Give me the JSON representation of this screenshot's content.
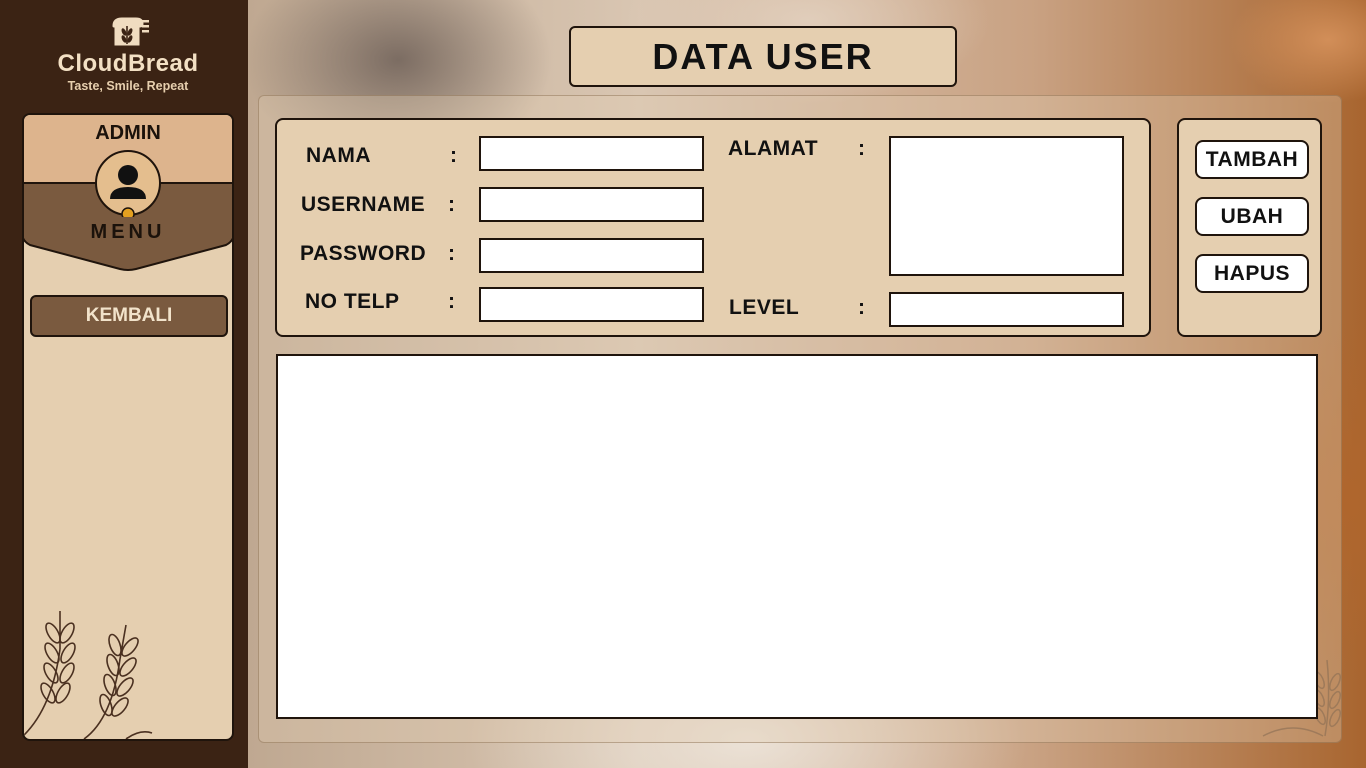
{
  "app": {
    "brand_name": "CloudBread",
    "tagline": "Taste, Smile, Repeat",
    "page_title": "DATA USER"
  },
  "sidebar": {
    "role_label": "ADMIN",
    "menu_label": "MENU",
    "back_button_label": "KEMBALI"
  },
  "form": {
    "nama": {
      "label": "NAMA",
      "colon": ":",
      "value": ""
    },
    "username": {
      "label": "USERNAME",
      "colon": ":",
      "value": ""
    },
    "password": {
      "label": "PASSWORD",
      "colon": ":",
      "value": ""
    },
    "no_telp": {
      "label": "NO TELP",
      "colon": ":",
      "value": ""
    },
    "alamat": {
      "label": "ALAMAT",
      "colon": ":",
      "value": ""
    },
    "level": {
      "label": "LEVEL",
      "colon": ":",
      "value": ""
    }
  },
  "actions": {
    "add_label": "TAMBAH",
    "edit_label": "UBAH",
    "delete_label": "HAPUS"
  },
  "table": {
    "rows": []
  },
  "colors": {
    "panel": "#e5cfb0",
    "sidebar_dark": "#3b2314",
    "button_brown": "#7a5a3f",
    "border": "#1f140c"
  },
  "icons": {
    "logo": "bread-wheat-icon",
    "avatar": "user-avatar-icon",
    "decoration": "wheat-stalks-icon"
  }
}
